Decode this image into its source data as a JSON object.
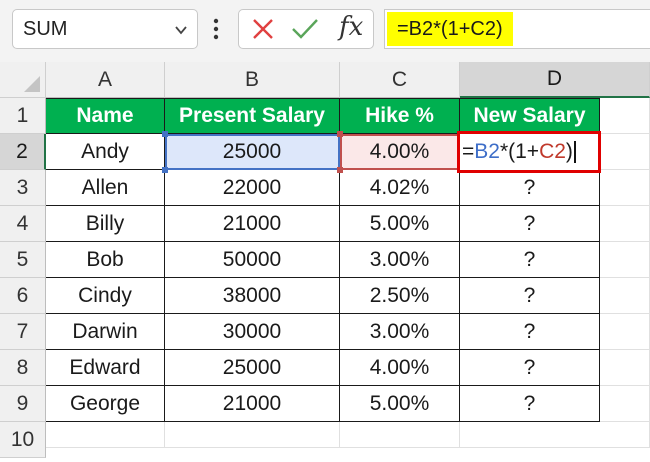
{
  "formula_bar": {
    "name_box": "SUM",
    "formula": "=B2*(1+C2)",
    "fx_label": "fx"
  },
  "columns": [
    "A",
    "B",
    "C",
    "D"
  ],
  "rows": [
    "1",
    "2",
    "3",
    "4",
    "5",
    "6",
    "7",
    "8",
    "9",
    "10"
  ],
  "table": {
    "headers": [
      "Name",
      "Present Salary",
      "Hike %",
      "New Salary"
    ],
    "data": [
      [
        "Andy",
        "25000",
        "4.00%",
        ""
      ],
      [
        "Allen",
        "22000",
        "4.02%",
        "?"
      ],
      [
        "Billy",
        "21000",
        "5.00%",
        "?"
      ],
      [
        "Bob",
        "50000",
        "3.00%",
        "?"
      ],
      [
        "Cindy",
        "38000",
        "2.50%",
        "?"
      ],
      [
        "Darwin",
        "30000",
        "3.00%",
        "?"
      ],
      [
        "Edward",
        "25000",
        "4.00%",
        "?"
      ],
      [
        "George",
        "21000",
        "5.00%",
        "?"
      ]
    ]
  },
  "editing_cell": {
    "address": "D2",
    "tokens": {
      "eq": "=",
      "ref1": "B2",
      "op": "*(1+",
      "ref2": "C2",
      "close": ")"
    }
  },
  "colors": {
    "header_fill": "#00b050",
    "formula_highlight": "#ffff00",
    "ref_b2": "#4472c4",
    "ref_c2": "#c0504d",
    "edit_border": "#e00000"
  }
}
